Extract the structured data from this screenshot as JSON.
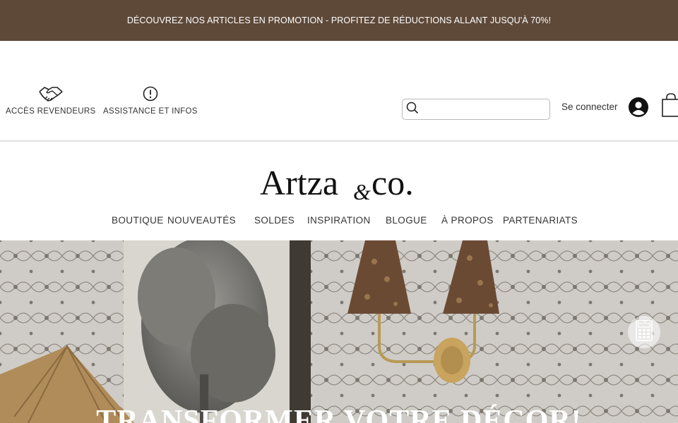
{
  "promo": {
    "text": "DÉCOUVREZ NOS ARTICLES EN PROMOTION - PROFITEZ DE RÉDUCTIONS ALLANT JUSQU'À 70%!"
  },
  "utility": {
    "reseller_label": "ACCÈS REVENDEURS",
    "assistance_label": "ASSISTANCE ET INFOS",
    "search_value": "",
    "search_placeholder": "",
    "login_label": "Se connecter"
  },
  "brand": {
    "logo_text": "Artza & co."
  },
  "nav": {
    "items": [
      "BOUTIQUE",
      "NOUVEAUTÉS",
      "SOLDES",
      "INSPIRATION",
      "BLOGUE",
      "À PROPOS",
      "PARTENARIATS"
    ]
  },
  "hero": {
    "title": "TRANSFORMER VOTRE DÉCOR!"
  },
  "icons": {
    "reseller": "handshake-icon",
    "assistance": "info-circle-icon",
    "search": "search-icon",
    "account": "avatar-icon",
    "cart": "shopping-bag-icon",
    "calculator": "calculator-icon"
  },
  "colors": {
    "promo_bg": "#5e4939",
    "promo_text": "#ffffff",
    "text": "#333333"
  }
}
